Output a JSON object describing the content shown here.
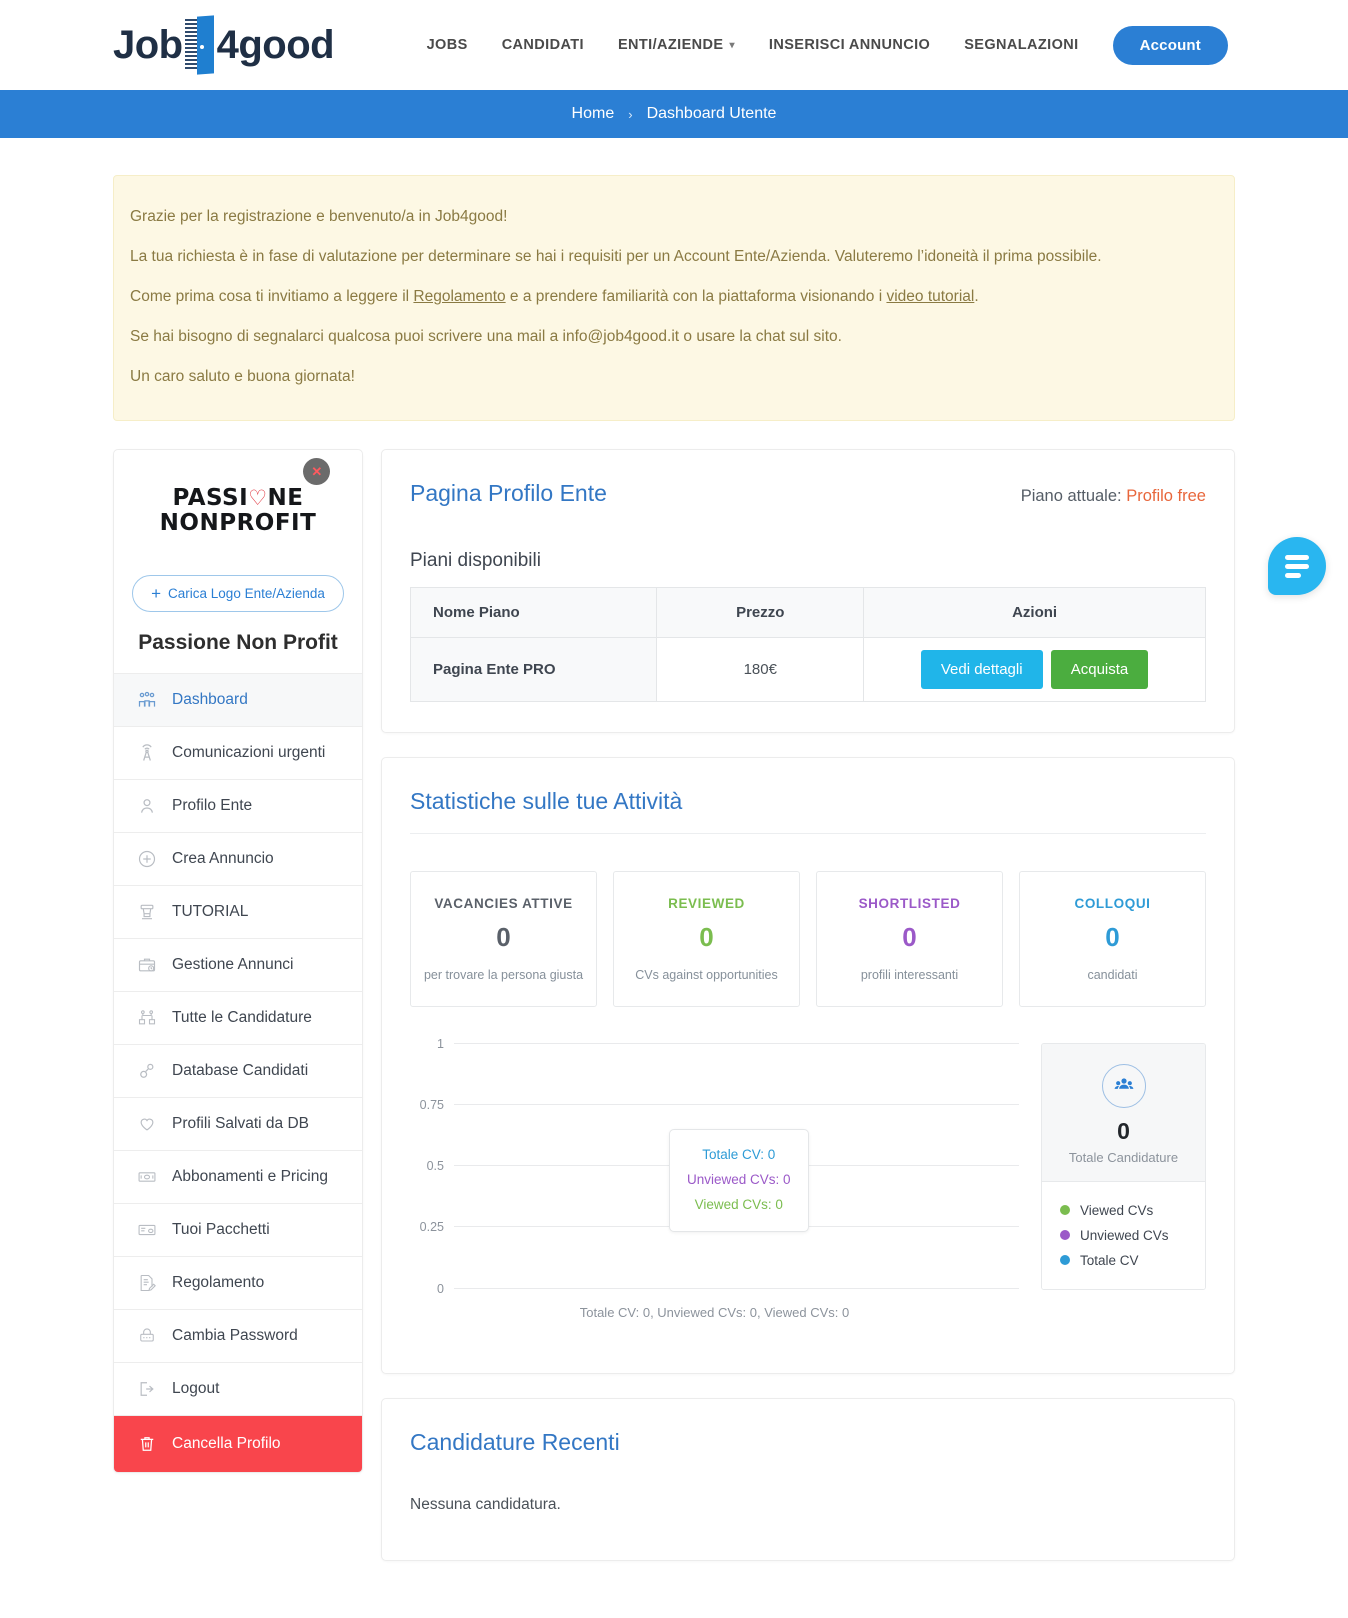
{
  "header": {
    "logo_text_1": "Job",
    "logo_text_2": "4good",
    "nav": [
      {
        "label": "JOBS",
        "has_caret": false
      },
      {
        "label": "CANDIDATI",
        "has_caret": false
      },
      {
        "label": "ENTI/AZIENDE",
        "has_caret": true
      },
      {
        "label": "INSERISCI ANNUNCIO",
        "has_caret": false
      },
      {
        "label": "SEGNALAZIONI",
        "has_caret": false
      }
    ],
    "account_button": "Account"
  },
  "breadcrumb": {
    "home": "Home",
    "separator": "›",
    "current": "Dashboard Utente"
  },
  "alert": {
    "line1": "Grazie per la registrazione e benvenuto/a in Job4good!",
    "line2": "La tua richiesta è in fase di valutazione per determinare se hai i requisiti per un Account Ente/Azienda. Valuteremo l’idoneità il prima possibile.",
    "line3_pre": "Come prima cosa ti  invitiamo a leggere il ",
    "line3_link1": "Regolamento",
    "line3_mid": " e a prendere familiarità con la piattaforma visionando i ",
    "line3_link2": "video tutorial",
    "line3_post": ".",
    "line4": "Se hai bisogno di segnalarci qualcosa puoi scrivere una mail a info@job4good.it o usare la chat sul sito.",
    "line5": "Un caro saluto e buona giornata!"
  },
  "sidebar": {
    "org_logo_line1_a": "PASSI",
    "org_logo_line1_heart": "♡",
    "org_logo_line1_b": "NE",
    "org_logo_line2": "NONPROFIT",
    "remove_logo_symbol": "✕",
    "upload_logo_label": "Carica Logo Ente/Azienda",
    "upload_logo_plus": "+",
    "org_name": "Passione Non Profit",
    "items": [
      {
        "label": "Dashboard",
        "icon": "people-group-icon",
        "active": true
      },
      {
        "label": "Comunicazioni urgenti",
        "icon": "broadcast-tower-icon",
        "active": false
      },
      {
        "label": "Profilo Ente",
        "icon": "user-icon",
        "active": false
      },
      {
        "label": "Crea Annuncio",
        "icon": "plus-circle-icon",
        "active": false
      },
      {
        "label": "TUTORIAL",
        "icon": "projector-icon",
        "active": false
      },
      {
        "label": "Gestione Annunci",
        "icon": "briefcase-clock-icon",
        "active": false
      },
      {
        "label": "Tutte le Candidature",
        "icon": "org-chart-icon",
        "active": false
      },
      {
        "label": "Database Candidati",
        "icon": "link-chain-icon",
        "active": false
      },
      {
        "label": "Profili Salvati da DB",
        "icon": "heart-icon",
        "active": false
      },
      {
        "label": "Abbonamenti e Pricing",
        "icon": "banknote-icon",
        "active": false
      },
      {
        "label": "Tuoi Pacchetti",
        "icon": "card-icon",
        "active": false
      },
      {
        "label": "Regolamento",
        "icon": "document-pen-icon",
        "active": false
      },
      {
        "label": "Cambia Password",
        "icon": "lock-icon",
        "active": false
      },
      {
        "label": "Logout",
        "icon": "logout-icon",
        "active": false
      }
    ],
    "delete_profile": {
      "label": "Cancella Profilo",
      "icon": "trash-icon"
    }
  },
  "profile_card": {
    "title": "Pagina Profilo Ente",
    "current_plan_label": "Piano attuale:",
    "current_plan_value": "Profilo free",
    "plans_subtitle": "Piani disponibili",
    "table": {
      "headers": [
        "Nome Piano",
        "Prezzo",
        "Azioni"
      ],
      "rows": [
        {
          "name": "Pagina Ente PRO",
          "price": "180€",
          "details_button": "Vedi dettagli",
          "buy_button": "Acquista"
        }
      ]
    }
  },
  "stats_card": {
    "title": "Statistiche sulle tue Attività",
    "cards": [
      {
        "label": "VACANCIES ATTIVE",
        "value": "0",
        "sub": "per trovare la persona giusta",
        "color": "#5a6069"
      },
      {
        "label": "REVIEWED",
        "value": "0",
        "sub": "CVs against opportunities",
        "color": "#7bbd4f"
      },
      {
        "label": "SHORTLISTED",
        "value": "0",
        "sub": "profili interessanti",
        "color": "#9b59c8"
      },
      {
        "label": "COLLOQUI",
        "value": "0",
        "sub": "candidati",
        "color": "#2e9bd6"
      }
    ],
    "side_panel": {
      "icon": "people-group-icon",
      "value": "0",
      "label": "Totale Candidature",
      "legend": [
        {
          "label": "Viewed CVs",
          "color": "#7bbd4f"
        },
        {
          "label": "Unviewed CVs",
          "color": "#9b59c8"
        },
        {
          "label": "Totale CV",
          "color": "#2e9bd6"
        }
      ]
    }
  },
  "chart_data": {
    "type": "line",
    "title": "",
    "xlabel": "Totale CV: 0, Unviewed CVs: 0, Viewed CVs: 0",
    "ylabel": "",
    "ylim": [
      0,
      1
    ],
    "yticks": [
      "1",
      "0.75",
      "0.5",
      "0.25",
      "0"
    ],
    "grid": true,
    "legend_position": "right",
    "categories": [
      ""
    ],
    "series": [
      {
        "name": "Totale CV",
        "values": [
          0
        ],
        "color": "#2e9bd6"
      },
      {
        "name": "Unviewed CVs",
        "values": [
          0
        ],
        "color": "#9b59c8"
      },
      {
        "name": "Viewed CVs",
        "values": [
          0
        ],
        "color": "#7bbd4f"
      }
    ],
    "tooltip": {
      "total": "Totale CV: 0",
      "unviewed": "Unviewed CVs: 0",
      "viewed": "Viewed CVs: 0"
    }
  },
  "recent_card": {
    "title": "Candidature Recenti",
    "empty": "Nessuna candidatura."
  },
  "chat": {
    "icon": "chat-bubble-icon"
  }
}
